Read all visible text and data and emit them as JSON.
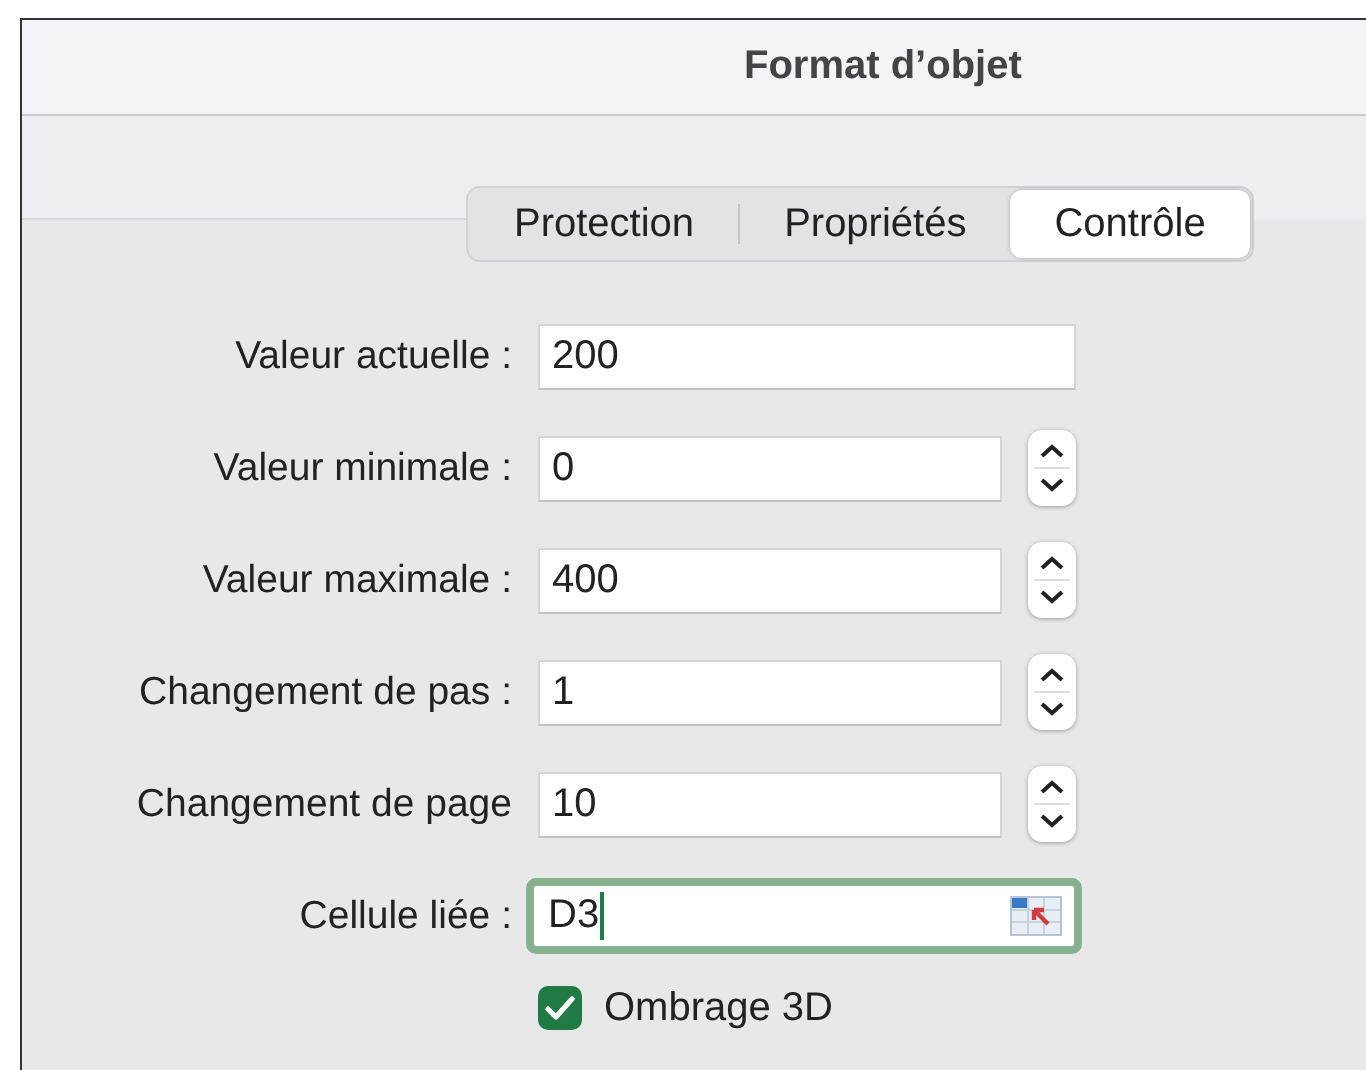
{
  "window": {
    "title": "Format d’objet"
  },
  "tabs": [
    {
      "label": "Protection",
      "selected": false
    },
    {
      "label": "Propriétés",
      "selected": false
    },
    {
      "label": "Contrôle",
      "selected": true
    }
  ],
  "fields": [
    {
      "label": "Valeur actuelle :",
      "value": "200",
      "kind": "plain",
      "focused": false
    },
    {
      "label": "Valeur minimale :",
      "value": "0",
      "kind": "stepper",
      "focused": false
    },
    {
      "label": "Valeur maximale :",
      "value": "400",
      "kind": "stepper",
      "focused": false
    },
    {
      "label": "Changement de pas :",
      "value": "1",
      "kind": "stepper",
      "focused": false
    },
    {
      "label": "Changement de page",
      "value": "10",
      "kind": "stepper",
      "focused": false
    },
    {
      "label": "Cellule liée :",
      "value": "D3",
      "kind": "linked",
      "focused": true
    }
  ],
  "checkbox": {
    "label": "Ombrage 3D",
    "checked": true
  }
}
